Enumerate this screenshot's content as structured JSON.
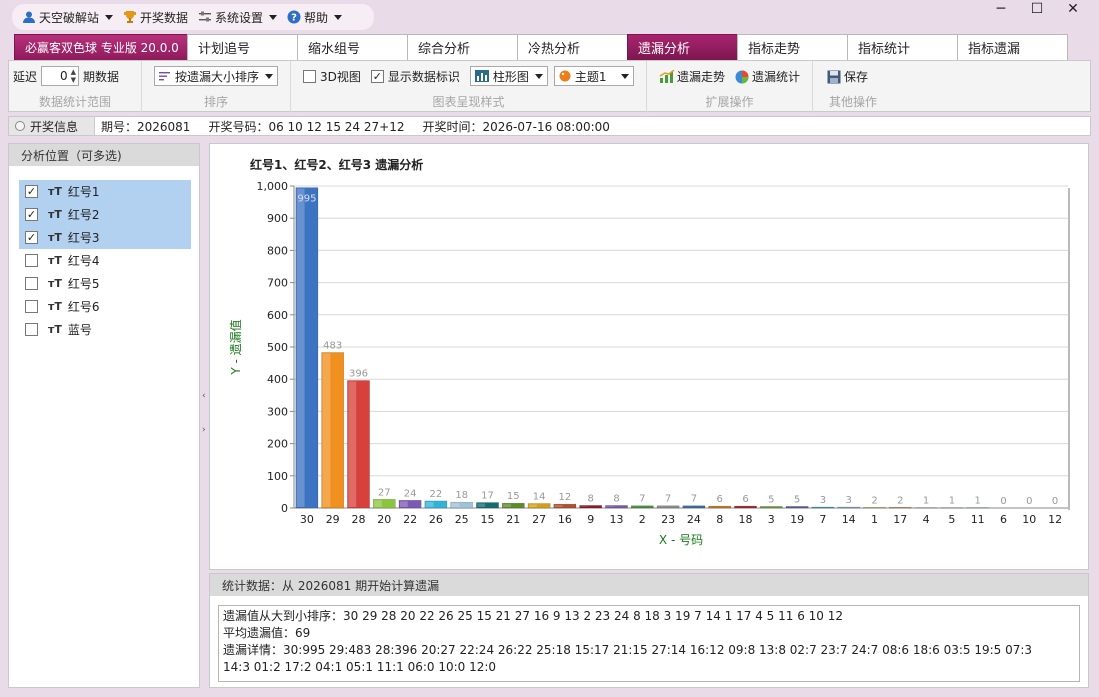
{
  "menu": {
    "items": [
      {
        "label": "天空破解站",
        "icon": "user-icon",
        "has_dropdown": true
      },
      {
        "label": "开奖数据",
        "icon": "trophy-icon",
        "has_dropdown": false
      },
      {
        "label": "系统设置",
        "icon": "sliders-icon",
        "has_dropdown": true
      },
      {
        "label": "帮助",
        "icon": "help-icon",
        "has_dropdown": true
      }
    ]
  },
  "window_controls": {
    "minimize": "─",
    "maximize": "☐",
    "close": "✕"
  },
  "tabs": [
    {
      "label": "必赢客双色球 专业版 20.0.0",
      "kind": "brand"
    },
    {
      "label": "计划追号"
    },
    {
      "label": "缩水组号"
    },
    {
      "label": "综合分析"
    },
    {
      "label": "冷热分析"
    },
    {
      "label": "遗漏分析",
      "active": true
    },
    {
      "label": "指标走势"
    },
    {
      "label": "指标统计"
    },
    {
      "label": "指标遗漏"
    }
  ],
  "ribbon": {
    "range": {
      "delay_label": "延迟",
      "delay_value": "0",
      "period_label": "期数据",
      "group_label": "数据统计范围"
    },
    "sort": {
      "dropdown": "按遗漏大小排序",
      "group_label": "排序"
    },
    "style": {
      "view3d": "3D视图",
      "view3d_checked": false,
      "show_labels": "显示数据标识",
      "show_labels_checked": true,
      "chart_type": "柱形图",
      "theme": "主题1",
      "group_label": "图表呈现样式"
    },
    "extend": {
      "trend": "遗漏走势",
      "stats": "遗漏统计",
      "group_label": "扩展操作"
    },
    "other": {
      "save": "保存",
      "group_label": "其他操作"
    }
  },
  "info": {
    "title": "开奖信息",
    "issue": "期号：2026081",
    "numbers": "开奖号码：06 10 12 15 24 27+12",
    "time": "开奖时间：2026-07-16 08:00:00"
  },
  "left_panel": {
    "title": "分析位置（可多选)",
    "items": [
      {
        "label": "红号1",
        "checked": true
      },
      {
        "label": "红号2",
        "checked": true
      },
      {
        "label": "红号3",
        "checked": true
      },
      {
        "label": "红号4",
        "checked": false
      },
      {
        "label": "红号5",
        "checked": false
      },
      {
        "label": "红号6",
        "checked": false
      },
      {
        "label": "蓝号",
        "checked": false
      }
    ]
  },
  "chart_data": {
    "type": "bar",
    "title": "红号1、红号2、红号3 遗漏分析",
    "xlabel": "X - 号码",
    "ylabel": "Y - 遗漏值",
    "ylim": [
      0,
      1000
    ],
    "yticks": [
      "0",
      "100",
      "200",
      "300",
      "400",
      "500",
      "600",
      "700",
      "800",
      "900",
      "1,000"
    ],
    "categories": [
      "30",
      "29",
      "28",
      "20",
      "22",
      "26",
      "25",
      "15",
      "21",
      "27",
      "16",
      "9",
      "13",
      "2",
      "23",
      "24",
      "8",
      "18",
      "3",
      "19",
      "7",
      "14",
      "1",
      "17",
      "4",
      "5",
      "11",
      "6",
      "10",
      "12"
    ],
    "values": [
      995,
      483,
      396,
      27,
      24,
      22,
      18,
      17,
      15,
      14,
      12,
      8,
      8,
      7,
      7,
      7,
      6,
      6,
      5,
      5,
      3,
      3,
      2,
      2,
      1,
      1,
      1,
      0,
      0,
      0
    ],
    "colors": [
      "#3d74c2",
      "#f0901e",
      "#d8403c",
      "#8cc63f",
      "#7b59b5",
      "#2fb4d8",
      "#9fc2d8",
      "#136b73",
      "#5c8b2b",
      "#d4a019",
      "#b05030",
      "#8b1a2a",
      "#7a5aa8",
      "#4a8f3a",
      "#8a8a8a",
      "#3a6a9a",
      "#c07820",
      "#a82828",
      "#6a9a3a",
      "#5a5aa0",
      "#2a9ab0",
      "#7aa0b8",
      "#a0a030",
      "#b86030",
      "#a06080",
      "#5a8aaa",
      "#3a8a5a",
      "#888888",
      "#aaaaaa",
      "#bbbbbb"
    ],
    "grid": true,
    "data_labels": true
  },
  "stats": {
    "header": "统计数据：从 2026081 期开始计算遗漏",
    "sorted": "遗漏值从大到小排序：30 29 28 20 22 26 25 15 21 27 16 9 13 2 23 24 8 18 3 19 7 14 1 17 4 5 11 6 10 12",
    "average": "平均遗漏值：69",
    "detail1": "遗漏详情：30:995  29:483  28:396  20:27  22:24  26:22  25:18  15:17  21:15  27:14  16:12  09:8  13:8  02:7  23:7  24:7  08:6  18:6  03:5  19:5  07:3",
    "detail2": "14:3  01:2  17:2  04:1  05:1  11:1  06:0  10:0  12:0"
  }
}
